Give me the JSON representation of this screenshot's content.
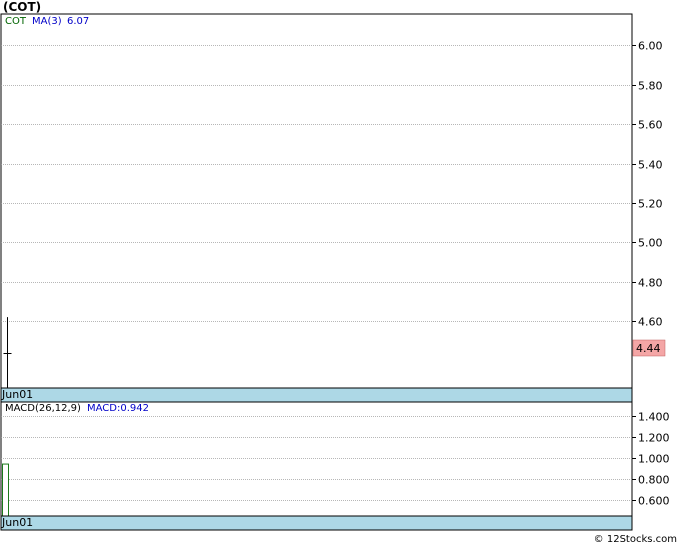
{
  "title": "(COT)",
  "footer": "© 12Stocks.com",
  "chart_data": [
    {
      "type": "line",
      "panel": "price",
      "legend": {
        "symbol": "COT",
        "ma_label": "MA(3)",
        "ma_value": "6.07"
      },
      "ylim": [
        4.26,
        6.16
      ],
      "yticks": [
        "6.00",
        "5.80",
        "5.60",
        "5.40",
        "5.20",
        "5.00",
        "4.80",
        "4.60"
      ],
      "x": [
        "Jun01"
      ],
      "ohlc": [
        {
          "date": "Jun01",
          "high": 4.62,
          "low": 4.07,
          "close": 4.44
        }
      ],
      "last_price_label": "4.44",
      "grid": true
    },
    {
      "type": "bar",
      "panel": "macd",
      "legend": {
        "name": "MACD(26,12,9)",
        "value_label": "MACD:0.942"
      },
      "ylim": [
        0.45,
        1.53
      ],
      "yticks": [
        "1.400",
        "1.200",
        "1.000",
        "0.800",
        "0.600"
      ],
      "x": [
        "Jun01"
      ],
      "values": [
        0.942
      ],
      "grid": true
    }
  ],
  "colors": {
    "axis_band": "#add8e6",
    "grid": "#a0a0a0",
    "price": "#000000",
    "symbol": "#006400",
    "ma": "#0000c8",
    "last_price_bg": "#f4a6a6",
    "macd_bar": "#1a7a1a"
  }
}
